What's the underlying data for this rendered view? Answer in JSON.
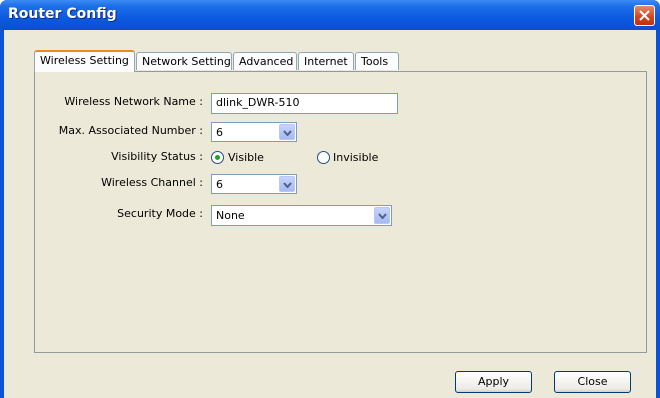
{
  "window": {
    "title": "Router Config"
  },
  "tabs": [
    {
      "label": "Wireless Setting",
      "active": true
    },
    {
      "label": "Network Setting",
      "active": false
    },
    {
      "label": "Advanced",
      "active": false
    },
    {
      "label": "Internet",
      "active": false
    },
    {
      "label": "Tools",
      "active": false
    }
  ],
  "form": {
    "network_name": {
      "label": "Wireless Network Name :",
      "value": "dlink_DWR-510"
    },
    "max_associated": {
      "label": "Max. Associated Number :",
      "value": "6"
    },
    "visibility": {
      "label": "Visibility Status :",
      "options": [
        "Visible",
        "Invisible"
      ],
      "selected": "Visible"
    },
    "channel": {
      "label": "Wireless Channel :",
      "value": "6"
    },
    "security": {
      "label": "Security Mode :",
      "value": "None"
    }
  },
  "buttons": {
    "apply": "Apply",
    "close": "Close"
  },
  "colors": {
    "title_bar": "#0a53d6",
    "dialog_bg": "#ece9d8",
    "active_tab_accent": "#e68b2c",
    "close_button": "#d2431e"
  },
  "icons": [
    "close-icon",
    "chevron-down-icon",
    "radio-icon"
  ]
}
